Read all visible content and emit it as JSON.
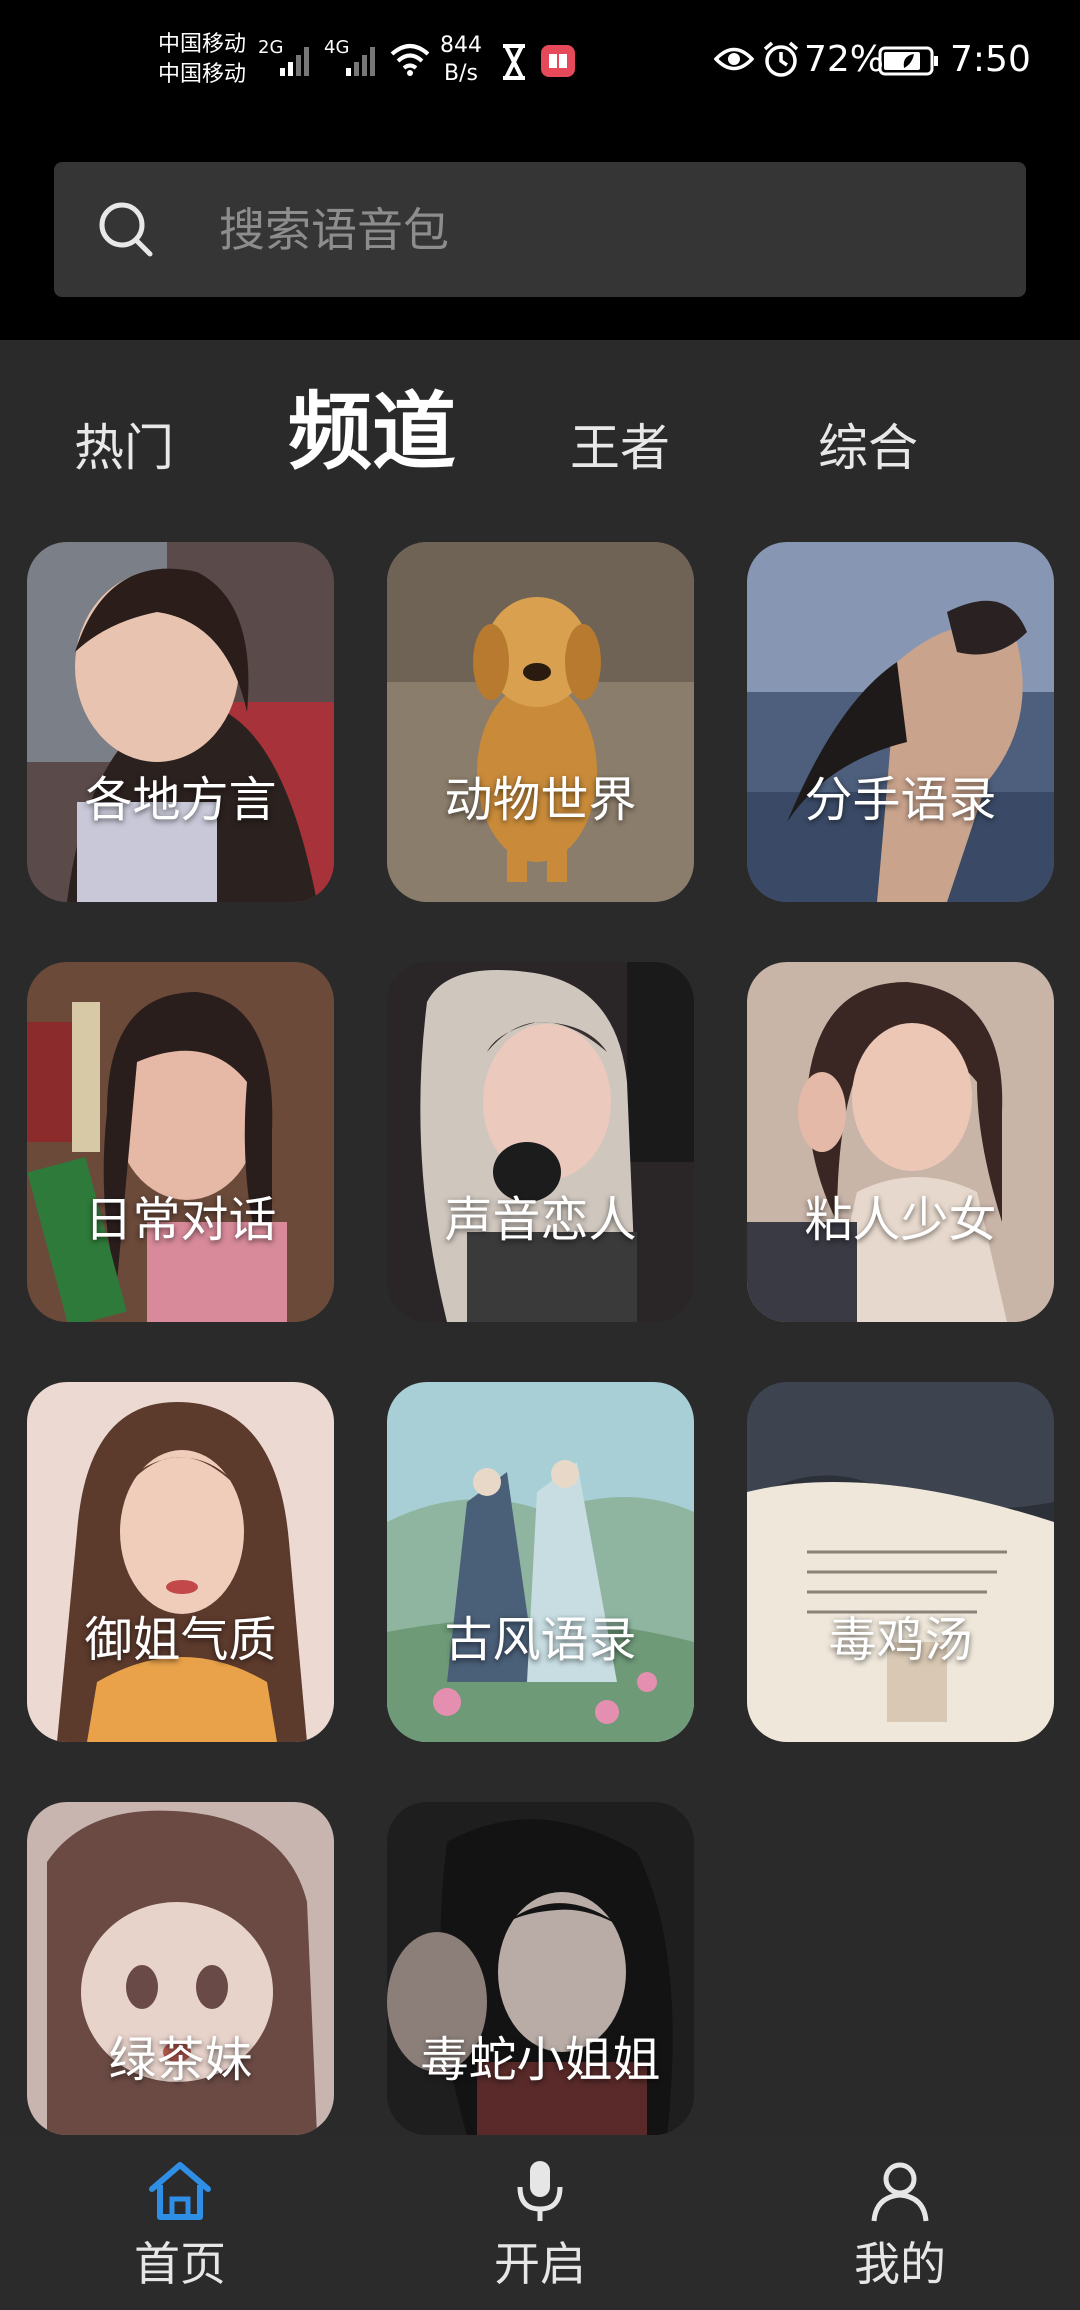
{
  "status_bar": {
    "carrier_1": "中国移动",
    "carrier_2": "中国移动",
    "signal_1_type": "2G",
    "signal_2_type": "4G",
    "net_speed_value": "844",
    "net_speed_unit": "B/s",
    "battery_percent": "72%",
    "time": "7:50"
  },
  "search": {
    "placeholder": "搜索语音包"
  },
  "tabs": [
    {
      "label": "热门",
      "active": false
    },
    {
      "label": "频道",
      "active": true
    },
    {
      "label": "王者",
      "active": false
    },
    {
      "label": "综合",
      "active": false
    }
  ],
  "cards": [
    {
      "label": "各地方言"
    },
    {
      "label": "动物世界"
    },
    {
      "label": "分手语录"
    },
    {
      "label": "日常对话"
    },
    {
      "label": "声音恋人"
    },
    {
      "label": "粘人少女"
    },
    {
      "label": "御姐气质"
    },
    {
      "label": "古风语录"
    },
    {
      "label": "毒鸡汤"
    },
    {
      "label": "绿茶妹"
    },
    {
      "label": "毒蛇小姐姐"
    }
  ],
  "bottom_nav": [
    {
      "label": "首页",
      "icon": "home-icon",
      "active": true
    },
    {
      "label": "开启",
      "icon": "microphone-icon",
      "active": false
    },
    {
      "label": "我的",
      "icon": "profile-icon",
      "active": false
    }
  ],
  "colors": {
    "active_nav": "#2f8fe6",
    "background": "#2a2a2a",
    "header": "#000000",
    "search_box": "#353535"
  }
}
